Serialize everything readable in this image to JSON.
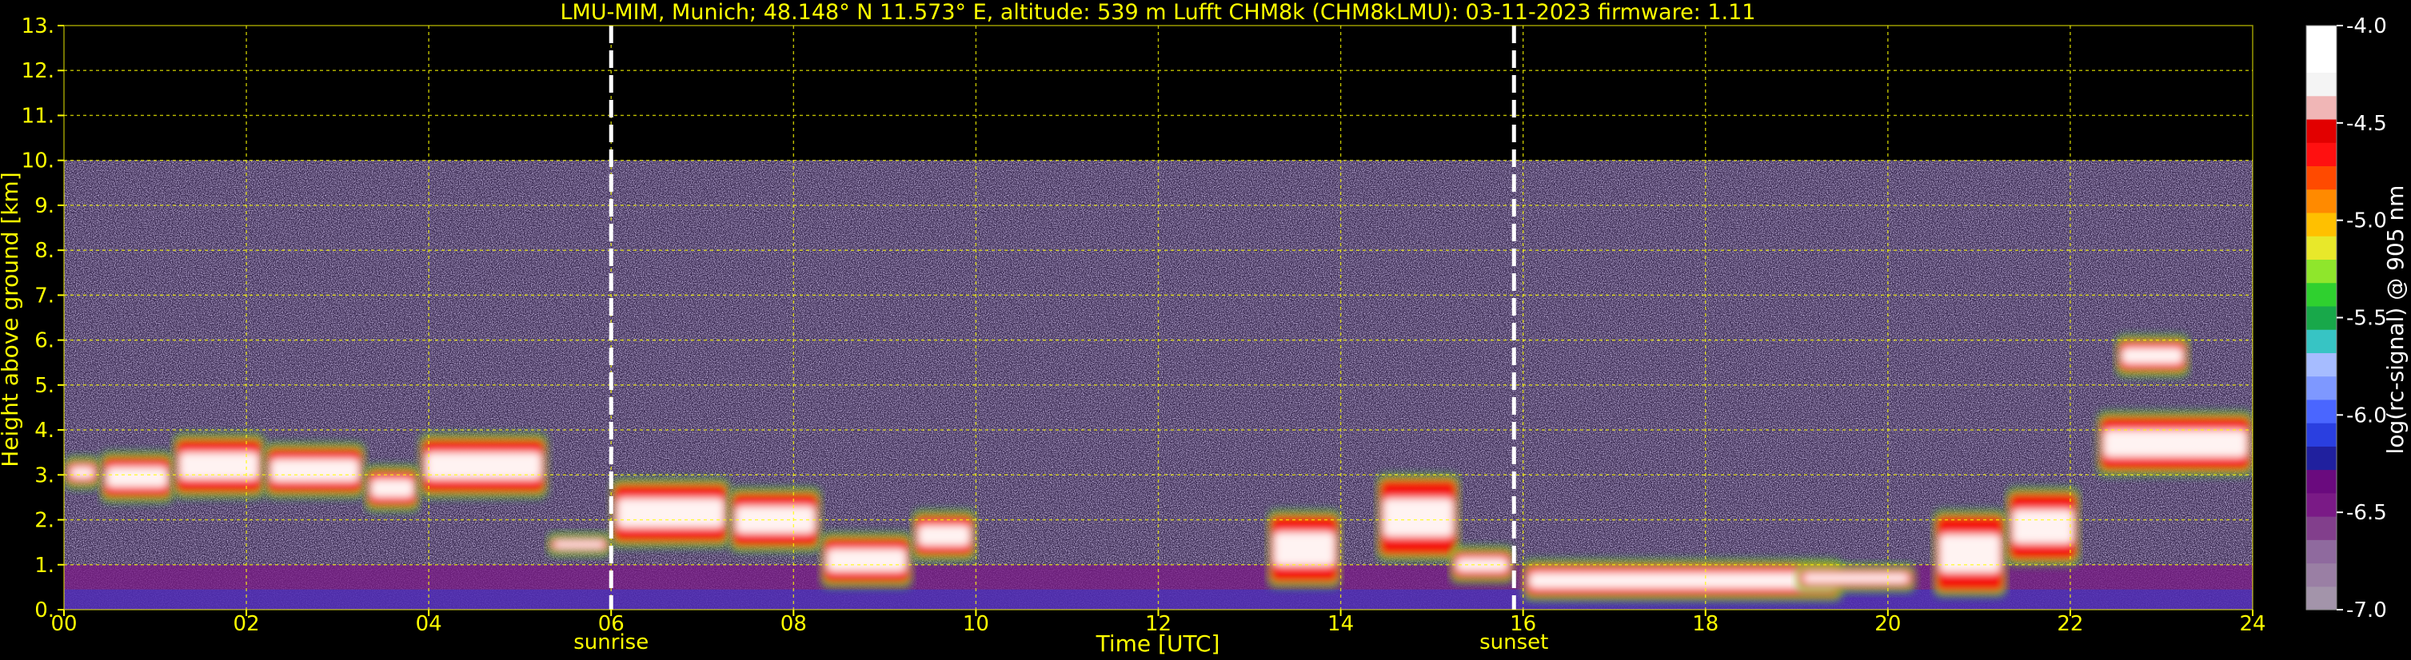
{
  "chart_data": {
    "type": "heatmap",
    "title": "LMU-MIM, Munich; 48.148° N 11.573° E, altitude: 539 m    Lufft CHM8k (CHM8kLMU): 03-11-2023    firmware: 1.11",
    "xlabel": "Time [UTC]",
    "ylabel": "Height above ground [km]",
    "xlim": [
      0,
      24
    ],
    "ylim": [
      0,
      13
    ],
    "x_ticks": [
      "00",
      "02",
      "04",
      "06",
      "08",
      "10",
      "12",
      "14",
      "16",
      "18",
      "20",
      "22",
      "24"
    ],
    "y_ticks": [
      "0.",
      "1.",
      "2.",
      "3.",
      "4.",
      "5.",
      "6.",
      "7.",
      "8.",
      "9.",
      "10.",
      "11.",
      "12.",
      "13."
    ],
    "grid": true,
    "signal_top_km": 10,
    "markers": [
      {
        "label": "sunrise",
        "time": 6.0
      },
      {
        "label": "sunset",
        "time": 15.9
      }
    ],
    "colorbar": {
      "label": "log(rc-signal) @ 905 nm",
      "range": [
        -7.0,
        -4.0
      ],
      "ticks": [
        "-4.0",
        "-4.5",
        "-5.0",
        "-5.5",
        "-6.0",
        "-6.5",
        "-7.0"
      ],
      "colors": [
        "#a394aa",
        "#9a7fa4",
        "#8f6a9e",
        "#823f8c",
        "#7a1a86",
        "#6a0a7e",
        "#20209e",
        "#2a3fe0",
        "#4a66ff",
        "#7e98ff",
        "#a6bcff",
        "#37c4c4",
        "#18a84a",
        "#2fd02f",
        "#8fe62c",
        "#e8e82a",
        "#ffc000",
        "#ff8a00",
        "#ff4a00",
        "#ff1010",
        "#e20000",
        "#f0b6b6",
        "#f4f4f4",
        "#ffffff",
        "#ffffff"
      ]
    },
    "cloud_layers": [
      {
        "t0": 0.0,
        "t1": 0.4,
        "base": 2.8,
        "top": 3.3
      },
      {
        "t0": 0.4,
        "t1": 1.2,
        "base": 2.5,
        "top": 3.4
      },
      {
        "t0": 1.2,
        "t1": 2.2,
        "base": 2.6,
        "top": 3.8
      },
      {
        "t0": 2.2,
        "t1": 3.3,
        "base": 2.6,
        "top": 3.6
      },
      {
        "t0": 3.3,
        "t1": 3.9,
        "base": 2.3,
        "top": 3.1
      },
      {
        "t0": 3.9,
        "t1": 5.3,
        "base": 2.6,
        "top": 3.8
      },
      {
        "t0": 5.3,
        "t1": 6.0,
        "base": 1.3,
        "top": 1.6
      },
      {
        "t0": 6.0,
        "t1": 7.3,
        "base": 1.5,
        "top": 2.8
      },
      {
        "t0": 7.3,
        "t1": 8.3,
        "base": 1.4,
        "top": 2.6
      },
      {
        "t0": 8.3,
        "t1": 9.3,
        "base": 0.6,
        "top": 1.6
      },
      {
        "t0": 9.3,
        "t1": 10.0,
        "base": 1.2,
        "top": 2.1
      },
      {
        "t0": 13.2,
        "t1": 14.0,
        "base": 0.6,
        "top": 2.1
      },
      {
        "t0": 14.4,
        "t1": 15.3,
        "base": 1.2,
        "top": 2.9
      },
      {
        "t0": 15.2,
        "t1": 15.9,
        "base": 0.7,
        "top": 1.3
      },
      {
        "t0": 16.0,
        "t1": 19.5,
        "base": 0.3,
        "top": 1.0
      },
      {
        "t0": 19.0,
        "t1": 20.3,
        "base": 0.5,
        "top": 0.9
      },
      {
        "t0": 20.5,
        "t1": 21.3,
        "base": 0.4,
        "top": 2.1
      },
      {
        "t0": 21.3,
        "t1": 22.1,
        "base": 1.1,
        "top": 2.6
      },
      {
        "t0": 22.3,
        "t1": 24.0,
        "base": 3.1,
        "top": 4.3
      },
      {
        "t0": 22.5,
        "t1": 23.3,
        "base": 5.3,
        "top": 6.0
      }
    ]
  }
}
